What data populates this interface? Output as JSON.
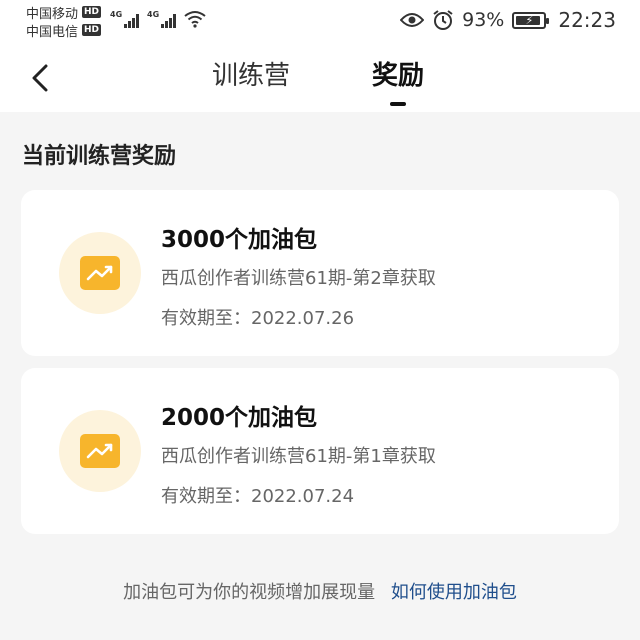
{
  "status_bar": {
    "carrier_1": "中国移动",
    "carrier_2": "中国电信",
    "hd_badge": "HD",
    "network": "4G",
    "battery": "93%",
    "time": "22:23"
  },
  "nav": {
    "tab_camp": "训练营",
    "tab_reward": "奖励",
    "active_tab": "奖励"
  },
  "section_title": "当前训练营奖励",
  "rewards": [
    {
      "title": "3000个加油包",
      "source": "西瓜创作者训练营61期-第2章获取",
      "expiry": "有效期至：2022.07.26"
    },
    {
      "title": "2000个加油包",
      "source": "西瓜创作者训练营61期-第1章获取",
      "expiry": "有效期至：2022.07.24"
    }
  ],
  "footer": {
    "note": "加油包可为你的视频增加展现量",
    "link": "如何使用加油包"
  },
  "colors": {
    "icon_bg": "#fdf3dc",
    "icon_fill": "#f7b52c",
    "link": "#1f4e8c"
  },
  "icons": {
    "reward": "trend-up-icon"
  }
}
